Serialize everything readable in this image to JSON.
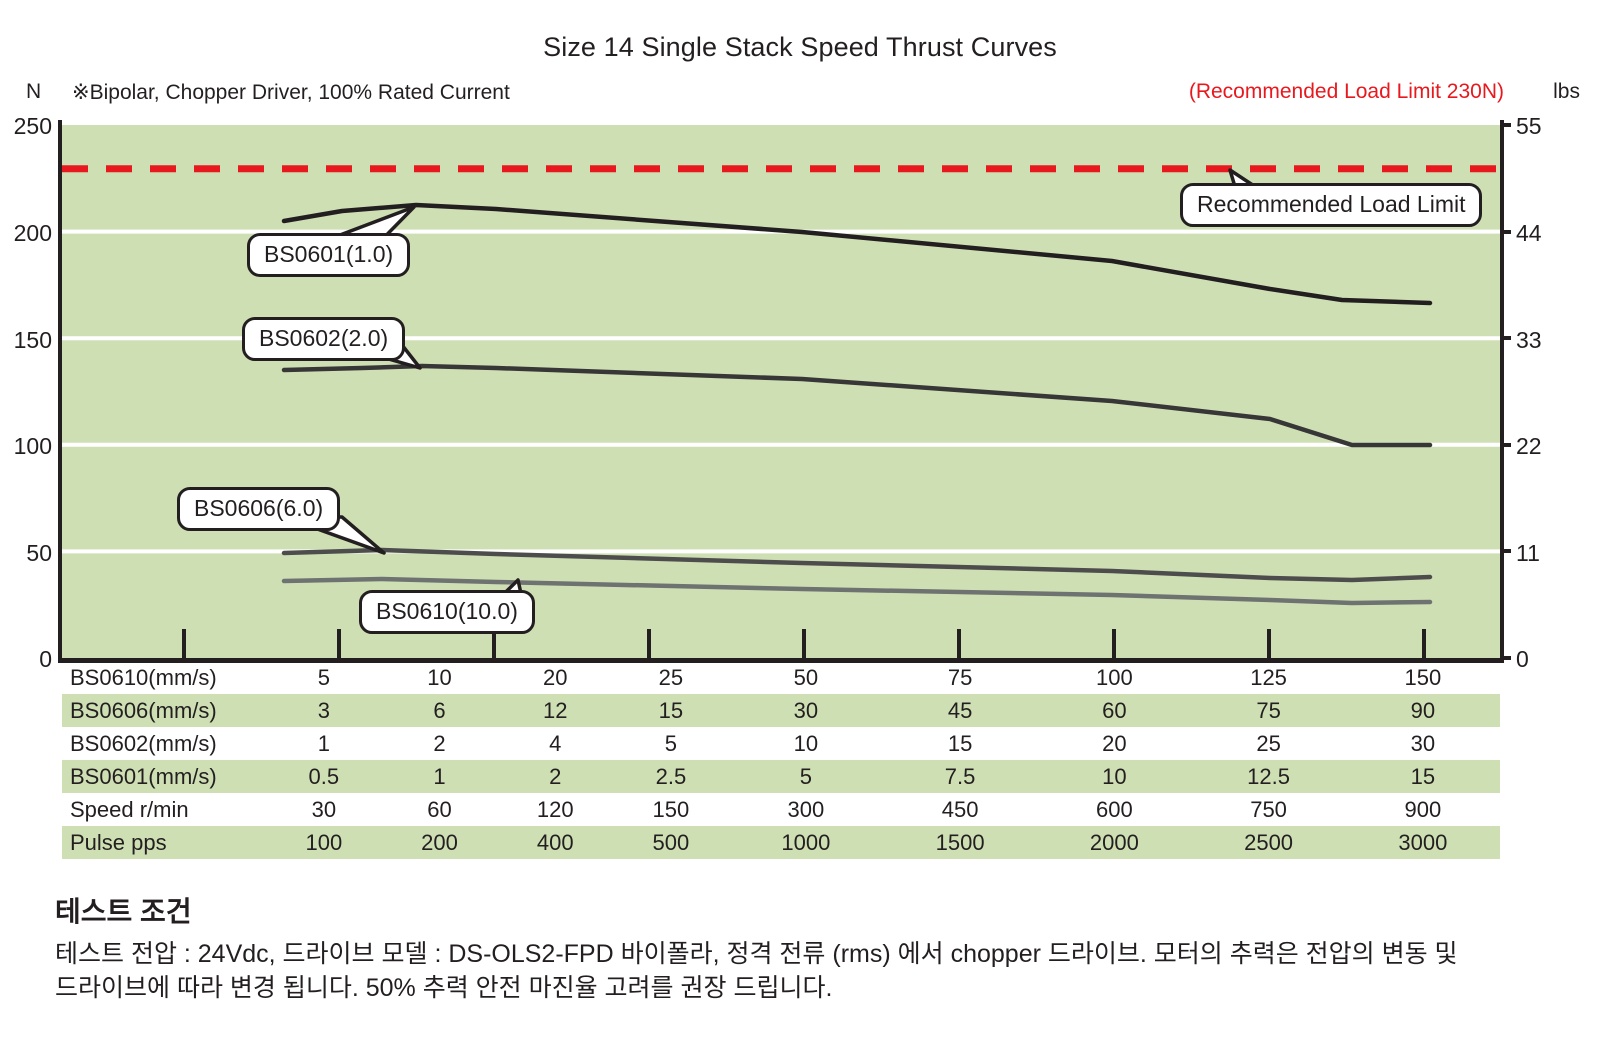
{
  "header": {
    "title": "Size 14 Single Stack Speed Thrust Curves",
    "unit_left": "N",
    "unit_right": "lbs",
    "note": "※Bipolar, Chopper Driver, 100% Rated Current",
    "limit_note": "(Recommended Load Limit 230N)"
  },
  "callouts": {
    "bs0601": "BS0601(1.0)",
    "bs0602": "BS0602(2.0)",
    "bs0606": "BS0606(6.0)",
    "bs0610": "BS0610(10.0)",
    "load_limit": "Recommended Load Limit"
  },
  "table": {
    "rows": [
      {
        "label": "BS0610(mm/s)",
        "values": [
          "5",
          "10",
          "20",
          "25",
          "50",
          "75",
          "100",
          "125",
          "150"
        ],
        "stripe": false
      },
      {
        "label": "BS0606(mm/s)",
        "values": [
          "3",
          "6",
          "12",
          "15",
          "30",
          "45",
          "60",
          "75",
          "90"
        ],
        "stripe": true
      },
      {
        "label": "BS0602(mm/s)",
        "values": [
          "1",
          "2",
          "4",
          "5",
          "10",
          "15",
          "20",
          "25",
          "30"
        ],
        "stripe": false
      },
      {
        "label": "BS0601(mm/s)",
        "values": [
          "0.5",
          "1",
          "2",
          "2.5",
          "5",
          "7.5",
          "10",
          "12.5",
          "15"
        ],
        "stripe": true
      },
      {
        "label": "Speed r/min",
        "values": [
          "30",
          "60",
          "120",
          "150",
          "300",
          "450",
          "600",
          "750",
          "900"
        ],
        "stripe": false
      },
      {
        "label": "Pulse  pps",
        "values": [
          "100",
          "200",
          "400",
          "500",
          "1000",
          "1500",
          "2000",
          "2500",
          "3000"
        ],
        "stripe": true
      }
    ]
  },
  "footer": {
    "title": "테스트 조건",
    "body": "테스트 전압 : 24Vdc, 드라이브 모델 : DS-OLS2-FPD 바이폴라, 정격 전류 (rms) 에서 chopper 드라이브. 모터의 추력은 전압의 변동 및 드라이브에 따라 변경 됩니다. 50% 추력 안전 마진율 고려를 권장 드립니다."
  },
  "colors": {
    "plot_bg": "#cfdfb4",
    "grid": "#ffffff",
    "limit_line": "#e8191e",
    "axis": "#231f20",
    "curve_dark": "#231f20",
    "curve_mid": "#4d4d4d",
    "curve_light": "#6e7271"
  },
  "chart_data": {
    "type": "line",
    "title": "Size 14 Single Stack Speed Thrust Curves",
    "xlabel": "",
    "ylabel": "N",
    "ylabel_right": "lbs",
    "ylim": [
      0,
      250
    ],
    "ylim_right": [
      0,
      55
    ],
    "yticks": [
      0,
      50,
      100,
      150,
      200,
      250
    ],
    "yticks_right": [
      0,
      11,
      22,
      33,
      44,
      55
    ],
    "grid": true,
    "legend": "callouts on curves",
    "x_pulse_pps": [
      100,
      200,
      400,
      500,
      1000,
      1500,
      2000,
      2500,
      3000
    ],
    "x_speed_rmin": [
      30,
      60,
      120,
      150,
      300,
      450,
      600,
      750,
      900
    ],
    "annotations": [
      {
        "text": "Recommended Load Limit",
        "value": 230,
        "style": "red dashed horizontal line"
      }
    ],
    "series": [
      {
        "name": "BS0601(1.0)",
        "color": "#231f20",
        "x_start_pps": 250,
        "x": [
          250,
          400,
          500,
          1000,
          1500,
          2000,
          2500,
          3000
        ],
        "values": [
          205,
          209,
          207,
          200,
          186,
          171,
          157,
          151
        ]
      },
      {
        "name": "BS0602(2.0)",
        "color": "#3a3a3a",
        "x_start_pps": 250,
        "x": [
          250,
          400,
          500,
          1000,
          1500,
          2000,
          2500,
          3000
        ],
        "values": [
          135,
          137,
          136,
          131,
          120,
          111,
          102,
          100
        ]
      },
      {
        "name": "BS0606(6.0)",
        "color": "#4d4d4d",
        "x_start_pps": 250,
        "x": [
          250,
          400,
          500,
          1000,
          1500,
          2000,
          2500,
          3000
        ],
        "values": [
          49,
          51,
          50,
          47,
          45,
          43,
          40,
          38
        ]
      },
      {
        "name": "BS0610(10.0)",
        "color": "#6e7271",
        "x_start_pps": 250,
        "x": [
          250,
          400,
          500,
          1000,
          1500,
          2000,
          2500,
          3000
        ],
        "values": [
          36,
          37,
          37,
          35,
          34,
          33,
          30,
          28
        ]
      }
    ]
  }
}
